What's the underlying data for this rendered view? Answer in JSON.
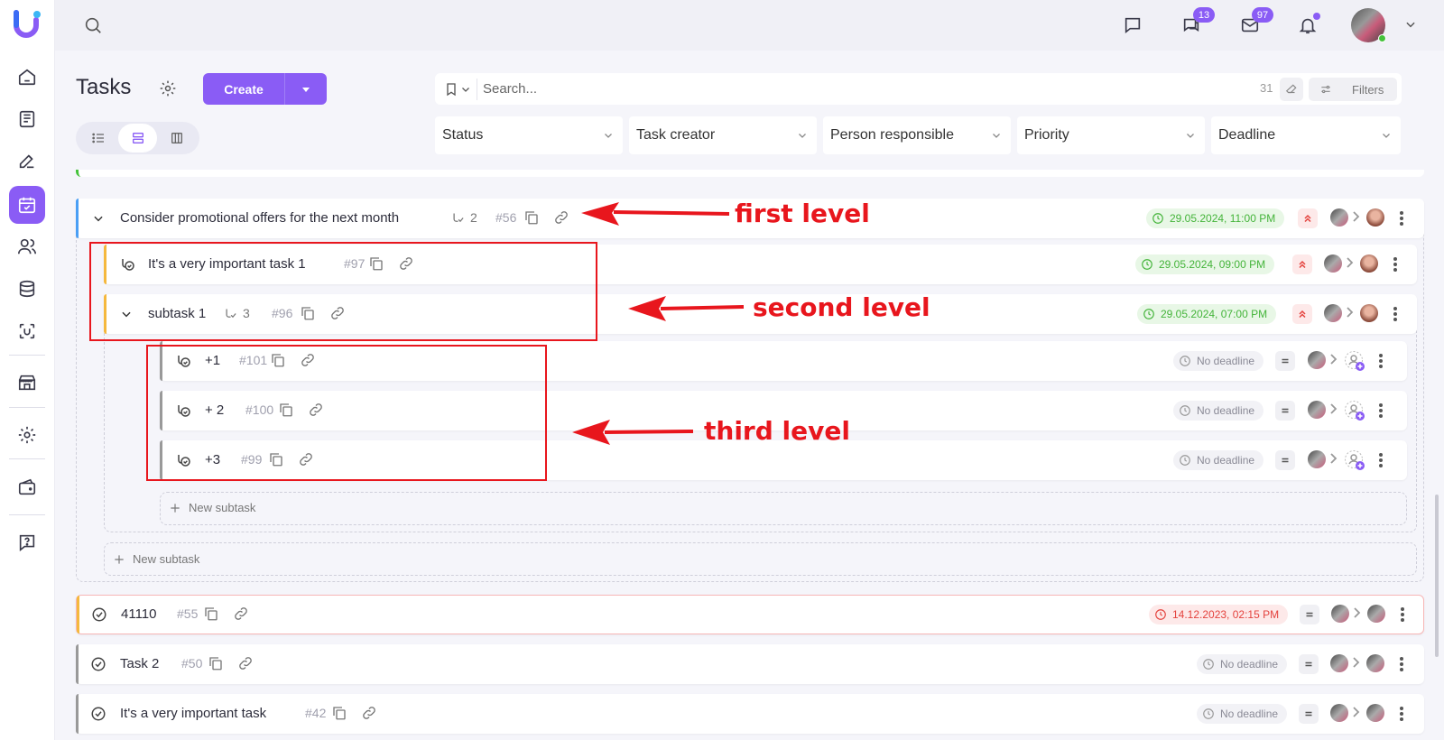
{
  "topbar": {
    "chats_badge": "13",
    "mail_badge": "97"
  },
  "header": {
    "title": "Tasks",
    "create_label": "Create"
  },
  "search": {
    "placeholder": "Search...",
    "count": "31",
    "filters_label": "Filters"
  },
  "filters": [
    "Status",
    "Task creator",
    "Person responsible",
    "Priority",
    "Deadline"
  ],
  "tasks": {
    "t56": {
      "title": "Consider promotional offers for the next month",
      "subtasks": "2",
      "id": "#56",
      "deadline": "29.05.2024, 11:00 PM"
    },
    "t97": {
      "title": "It's a very important task 1",
      "id": "#97",
      "deadline": "29.05.2024, 09:00 PM"
    },
    "t96": {
      "title": "subtask 1",
      "subtasks": "3",
      "id": "#96",
      "deadline": "29.05.2024, 07:00 PM"
    },
    "t101": {
      "title": "+1",
      "id": "#101",
      "deadline": "No deadline"
    },
    "t100": {
      "title": "+ 2",
      "id": "#100",
      "deadline": "No deadline"
    },
    "t99": {
      "title": "+3",
      "id": "#99",
      "deadline": "No deadline"
    },
    "t55": {
      "title": "41110",
      "id": "#55",
      "deadline": "14.12.2023, 02:15 PM"
    },
    "t50": {
      "title": "Task 2",
      "id": "#50",
      "deadline": "No deadline"
    },
    "t42": {
      "title": "It's a very important task",
      "id": "#42",
      "deadline": "No deadline"
    },
    "new_subtask": "New subtask"
  },
  "annotations": {
    "first": "first level",
    "second": "second level",
    "third": "third level",
    "color": "#e8161d"
  },
  "colors": {
    "accent": "#8a5cf5",
    "green": "#44b43a",
    "red": "#e4433e",
    "yellow": "#f5b83d"
  }
}
